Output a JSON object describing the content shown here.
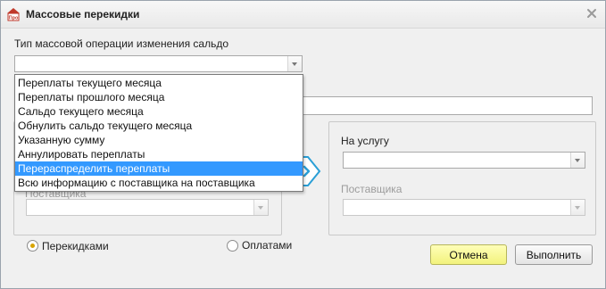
{
  "window": {
    "title": "Массовые перекидки",
    "app_icon_text": "Про"
  },
  "operation": {
    "label": "Тип массовой операции изменения сальдо",
    "value": "",
    "options": [
      "Переплаты текущего месяца",
      "Переплаты прошлого месяца",
      "Сальдо текущего месяца",
      "Обнулить сальдо текущего месяца",
      "Указанную сумму",
      "Аннулировать переплаты",
      "Перераспределить переплаты",
      "Всю информацию с поставщика на поставщика"
    ],
    "highlighted_index": 6
  },
  "comment": {
    "value": ""
  },
  "source": {
    "supplier_label": "Поставщика",
    "supplier_value": ""
  },
  "target": {
    "service_label": "На услугу",
    "service_value": "",
    "supplier_label": "Поставщика",
    "supplier_value": ""
  },
  "mode": {
    "options": [
      {
        "label": "Перекидками",
        "checked": true
      },
      {
        "label": "Оплатами",
        "checked": false
      }
    ]
  },
  "buttons": {
    "cancel": "Отмена",
    "execute": "Выполнить"
  },
  "colors": {
    "highlight": "#3399ff",
    "primary_button": "#f5f58a",
    "radio_selected": "#d8a400",
    "transfer_arrow": "#2a9fd6"
  }
}
